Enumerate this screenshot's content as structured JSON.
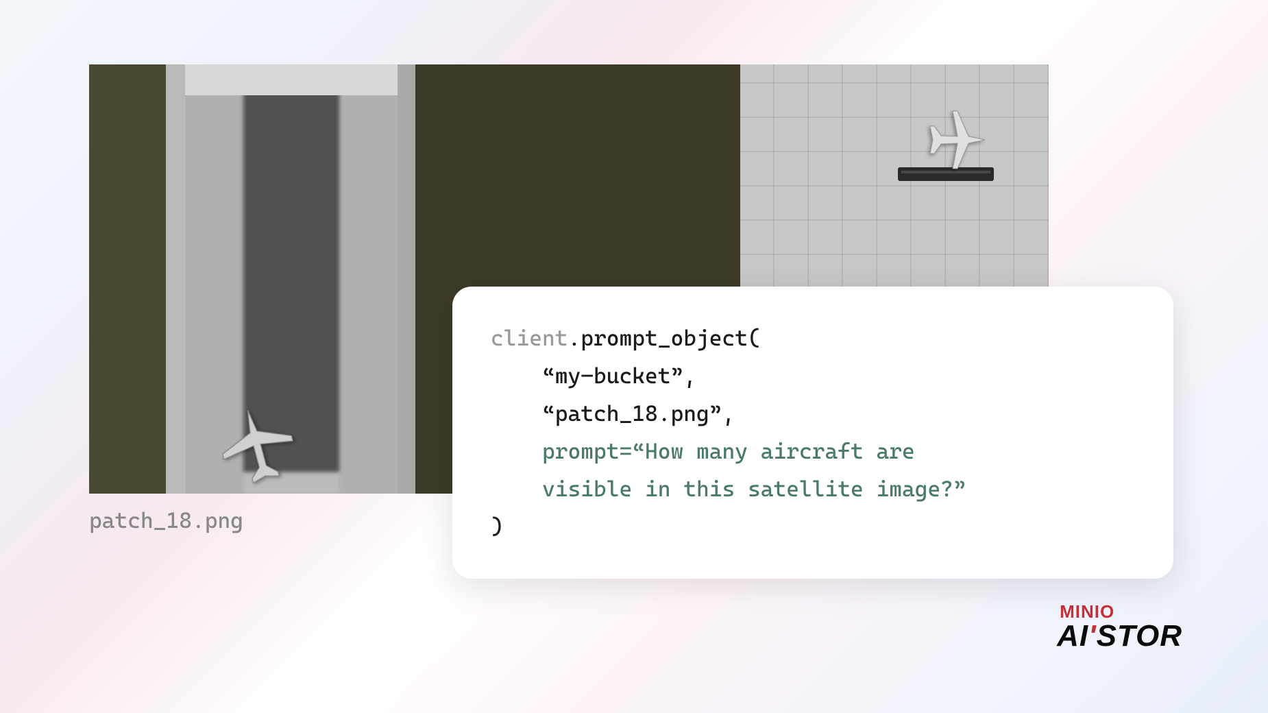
{
  "image": {
    "caption": "patch_18.png"
  },
  "code": {
    "line1_muted": "client",
    "line1_rest": ".prompt_object(",
    "line2": "    “my–bucket”,",
    "line3": "    “patch_18.png”,",
    "line4_key": "    prompt=",
    "line4_val": "“How many aircraft are",
    "line5_val": "    visible in this satellite image?”",
    "line6": ")"
  },
  "logo": {
    "brand_top": "MINIO",
    "brand_main_a": "AI",
    "brand_main_b": "STOR"
  }
}
